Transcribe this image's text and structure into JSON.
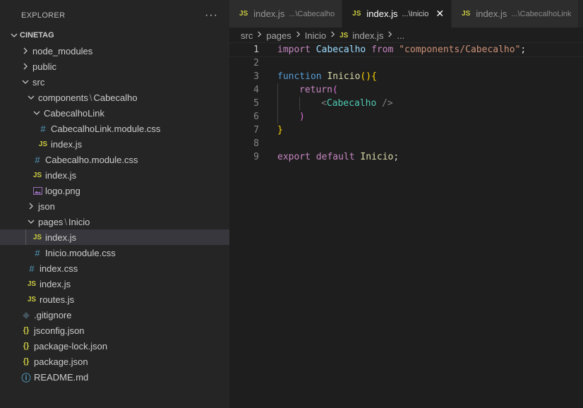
{
  "explorer": {
    "title": "EXPLORER",
    "more": "···",
    "root": "CINETAG",
    "items": [
      {
        "label": "node_modules",
        "type": "folder",
        "open": false,
        "depth": 1
      },
      {
        "label": "public",
        "type": "folder",
        "open": false,
        "depth": 1
      },
      {
        "label": "src",
        "type": "folder",
        "open": true,
        "depth": 1
      },
      {
        "label": "components",
        "label2": "Cabecalho",
        "type": "folder",
        "open": true,
        "depth": 2
      },
      {
        "label": "CabecalhoLink",
        "type": "folder",
        "open": true,
        "depth": 3
      },
      {
        "label": "CabecalhoLink.module.css",
        "type": "css",
        "depth": 4
      },
      {
        "label": "index.js",
        "type": "js",
        "depth": 4
      },
      {
        "label": "Cabecalho.module.css",
        "type": "css",
        "depth": 3
      },
      {
        "label": "index.js",
        "type": "js",
        "depth": 3
      },
      {
        "label": "logo.png",
        "type": "img",
        "depth": 3
      },
      {
        "label": "json",
        "type": "folder",
        "open": false,
        "depth": 2
      },
      {
        "label": "pages",
        "label2": "Inicio",
        "type": "folder",
        "open": true,
        "depth": 2
      },
      {
        "label": "index.js",
        "type": "js",
        "depth": 3,
        "selected": true
      },
      {
        "label": "Inicio.module.css",
        "type": "css",
        "depth": 3
      },
      {
        "label": "index.css",
        "type": "css",
        "depth": 2
      },
      {
        "label": "index.js",
        "type": "js",
        "depth": 2
      },
      {
        "label": "routes.js",
        "type": "js",
        "depth": 2
      },
      {
        "label": ".gitignore",
        "type": "git",
        "depth": 1
      },
      {
        "label": "jsconfig.json",
        "type": "json",
        "depth": 1
      },
      {
        "label": "package-lock.json",
        "type": "json",
        "depth": 1
      },
      {
        "label": "package.json",
        "type": "json",
        "depth": 1
      },
      {
        "label": "README.md",
        "type": "info",
        "depth": 1
      }
    ]
  },
  "icons": {
    "js": "JS",
    "css": "#",
    "json": "{}",
    "git": "◆",
    "info": "ⓘ",
    "close": "✕"
  },
  "tabs": [
    {
      "label": "index.js",
      "desc": "...\\Cabecalho",
      "active": false
    },
    {
      "label": "index.js",
      "desc": "...\\Inicio",
      "active": true
    },
    {
      "label": "index.js",
      "desc": "...\\CabecalhoLink",
      "active": false
    }
  ],
  "breadcrumb": {
    "parts": [
      "src",
      "pages",
      "Inicio"
    ],
    "file": "index.js",
    "tail": "..."
  },
  "code": {
    "line_numbers": [
      "1",
      "2",
      "3",
      "4",
      "5",
      "6",
      "7",
      "8",
      "9"
    ],
    "active_line": 1,
    "lines": [
      [
        {
          "t": "import ",
          "c": "kw"
        },
        {
          "t": "Cabecalho ",
          "c": "var"
        },
        {
          "t": "from ",
          "c": "kw"
        },
        {
          "t": "\"components/Cabecalho\"",
          "c": "str"
        },
        {
          "t": ";",
          "c": "plain"
        }
      ],
      [],
      [
        {
          "t": "function ",
          "c": "kw2"
        },
        {
          "t": "Inicio",
          "c": "fn"
        },
        {
          "t": "(){",
          "c": "br1"
        }
      ],
      [
        {
          "t": "return",
          "c": "kw"
        },
        {
          "t": "(",
          "c": "br2"
        }
      ],
      [
        {
          "t": "<",
          "c": "punct"
        },
        {
          "t": "Cabecalho ",
          "c": "tag"
        },
        {
          "t": "/>",
          "c": "punct"
        }
      ],
      [
        {
          "t": ")",
          "c": "br2"
        }
      ],
      [
        {
          "t": "}",
          "c": "br1"
        }
      ],
      [],
      [
        {
          "t": "export ",
          "c": "kw"
        },
        {
          "t": "default ",
          "c": "kw"
        },
        {
          "t": "Inicio",
          "c": "fn"
        },
        {
          "t": ";",
          "c": "plain"
        }
      ]
    ]
  }
}
